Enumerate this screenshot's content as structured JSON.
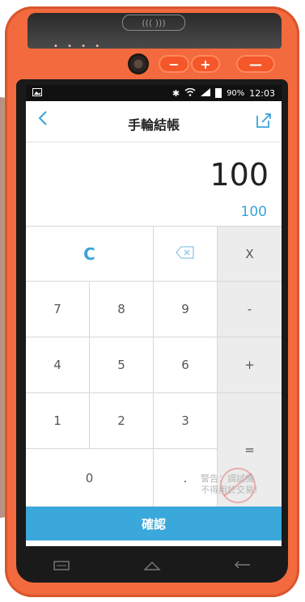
{
  "hardware": {
    "nfc_label": "((( )))",
    "speaker": "• • • •",
    "minus_btn": "−",
    "plus_btn": "+",
    "dash_btn": "—"
  },
  "status": {
    "left_icon": "image-icon",
    "battery": "90%",
    "time": "12:03"
  },
  "appbar": {
    "title": "手輪結帳",
    "back": "<"
  },
  "display": {
    "amount": "100",
    "secondary": "100"
  },
  "keys": {
    "clear": "C",
    "multiply": "X",
    "minus": "-",
    "plus": "+",
    "equals": "=",
    "dot": ".",
    "n7": "7",
    "n8": "8",
    "n9": "9",
    "n4": "4",
    "n5": "5",
    "n6": "6",
    "n1": "1",
    "n2": "2",
    "n3": "3",
    "n0": "0"
  },
  "confirm_label": "確認",
  "watermark": {
    "line1": "警告：調試機",
    "line2": "不得用於交易!"
  },
  "colors": {
    "accent": "#3aa8db",
    "device": "#f26a3d"
  }
}
